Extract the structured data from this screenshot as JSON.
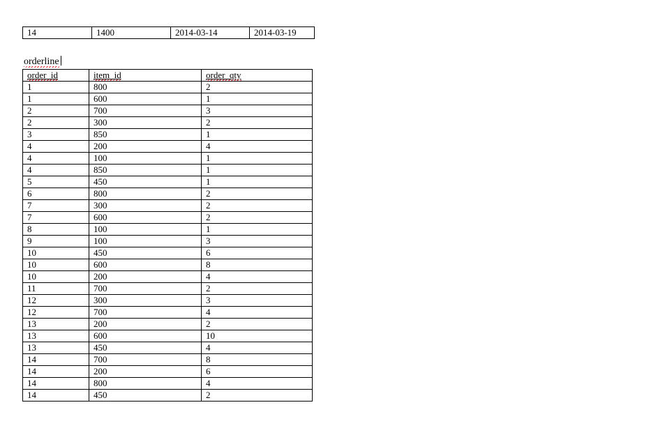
{
  "top_row": {
    "c0": "14",
    "c1": "1400",
    "c2": "2014-03-14",
    "c3": "2014-03-19"
  },
  "orderline": {
    "title": "orderline",
    "headers": {
      "h0": "order_id",
      "h1": "item_id",
      "h2": "order_qty"
    },
    "rows": [
      {
        "order_id": "1",
        "item_id": "800",
        "order_qty": "2"
      },
      {
        "order_id": "1",
        "item_id": "600",
        "order_qty": "1"
      },
      {
        "order_id": "2",
        "item_id": "700",
        "order_qty": "3"
      },
      {
        "order_id": "2",
        "item_id": "300",
        "order_qty": "2"
      },
      {
        "order_id": "3",
        "item_id": "850",
        "order_qty": "1"
      },
      {
        "order_id": "4",
        "item_id": "200",
        "order_qty": "4"
      },
      {
        "order_id": "4",
        "item_id": "100",
        "order_qty": "1"
      },
      {
        "order_id": "4",
        "item_id": "850",
        "order_qty": "1"
      },
      {
        "order_id": "5",
        "item_id": "450",
        "order_qty": "1"
      },
      {
        "order_id": "6",
        "item_id": "800",
        "order_qty": "2"
      },
      {
        "order_id": "7",
        "item_id": "300",
        "order_qty": "2"
      },
      {
        "order_id": "7",
        "item_id": "600",
        "order_qty": "2"
      },
      {
        "order_id": "8",
        "item_id": "100",
        "order_qty": "1"
      },
      {
        "order_id": "9",
        "item_id": "100",
        "order_qty": "3"
      },
      {
        "order_id": "10",
        "item_id": "450",
        "order_qty": "6"
      },
      {
        "order_id": "10",
        "item_id": "600",
        "order_qty": "8"
      },
      {
        "order_id": "10",
        "item_id": "200",
        "order_qty": "4"
      },
      {
        "order_id": "11",
        "item_id": "700",
        "order_qty": "2"
      },
      {
        "order_id": "12",
        "item_id": "300",
        "order_qty": "3"
      },
      {
        "order_id": "12",
        "item_id": "700",
        "order_qty": "4"
      },
      {
        "order_id": "13",
        "item_id": "200",
        "order_qty": "2"
      },
      {
        "order_id": "13",
        "item_id": "600",
        "order_qty": "10"
      },
      {
        "order_id": "13",
        "item_id": "450",
        "order_qty": "4"
      },
      {
        "order_id": "14",
        "item_id": "700",
        "order_qty": "8"
      },
      {
        "order_id": "14",
        "item_id": "200",
        "order_qty": "6"
      },
      {
        "order_id": "14",
        "item_id": "800",
        "order_qty": "4"
      },
      {
        "order_id": "14",
        "item_id": "450",
        "order_qty": "2"
      }
    ]
  }
}
